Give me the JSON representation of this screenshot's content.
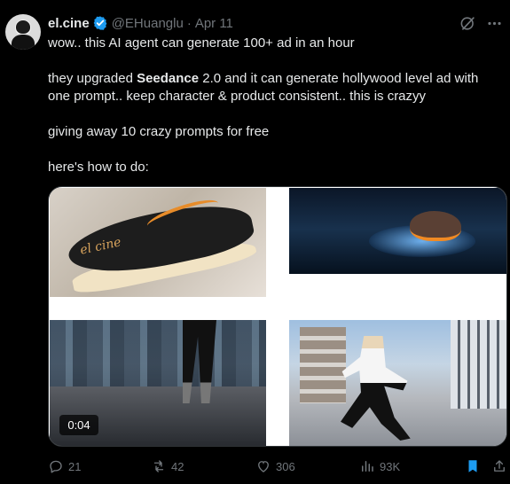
{
  "post": {
    "author": {
      "display_name": "el.cine",
      "handle": "@EHuanglu",
      "date": "Apr 11",
      "separator": "·"
    },
    "icons": {
      "verified": "verified-badge-icon",
      "grok": "grok-icon",
      "more": "more-options-icon"
    },
    "content": {
      "line_1": "wow.. this AI agent can generate 100+ ad in an hour",
      "line_2_prefix": "they upgraded ",
      "line_2_bold": "Seedance",
      "line_2_suffix": " 2.0 and it can generate hollywood level ad with one prompt.. keep character & product consistent.. this is crazyy",
      "line_3": "giving away 10 crazy prompts for free",
      "line_4": "here's how to do:"
    },
    "media": {
      "video_time": "0:04",
      "shoe_logo": "el cine"
    },
    "actions": {
      "replies": "21",
      "reposts": "42",
      "likes": "306",
      "views": "93K"
    },
    "colors": {
      "background": "#000000",
      "text": "#e7e9ea",
      "muted": "#71767b",
      "accent": "#1d9bf0"
    }
  }
}
